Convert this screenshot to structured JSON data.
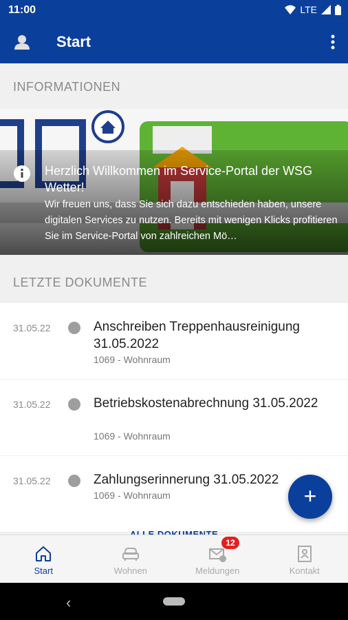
{
  "status": {
    "time": "11:00",
    "network": "LTE"
  },
  "appbar": {
    "title": "Start"
  },
  "sections": {
    "info": "INFORMATIONEN",
    "docs": "LETZTE DOKUMENTE"
  },
  "banner": {
    "title": "Herzlich Willkommen im Service-Portal der WSG Wetter!",
    "text": "Wir freuen uns, dass Sie sich dazu entschieden haben, unsere digitalen Services zu nutzen. Bereits mit wenigen Klicks profitieren Sie im Service-Portal von zahlreichen Mö…"
  },
  "documents": [
    {
      "date": "31.05.22",
      "title": "Anschreiben Treppenhausreinigung 31.05.2022",
      "subtitle": "1069 - Wohnraum"
    },
    {
      "date": "31.05.22",
      "title": "Betriebskostenabrechnung 31.05.2022",
      "subtitle": "1069 - Wohnraum"
    },
    {
      "date": "31.05.22",
      "title": "Zahlungserinnerung 31.05.2022",
      "subtitle": "1069 - Wohnraum"
    }
  ],
  "all_docs_label": "ALLE DOKUMENTE",
  "fab_label": "+",
  "bottomnav": [
    {
      "label": "Start",
      "icon": "home-icon"
    },
    {
      "label": "Wohnen",
      "icon": "sofa-icon"
    },
    {
      "label": "Meldungen",
      "icon": "mail-icon"
    },
    {
      "label": "Kontakt",
      "icon": "contact-book-icon"
    }
  ],
  "badge_count": "12",
  "colors": {
    "primary": "#0b3f9c",
    "badge": "#e32020"
  }
}
